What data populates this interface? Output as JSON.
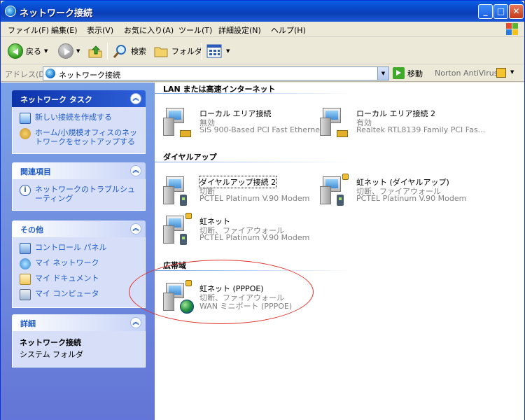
{
  "window": {
    "title": "ネットワーク接続",
    "min": "_",
    "max": "□",
    "close": "✕"
  },
  "menu": [
    "ファイル(F)",
    "編集(E)",
    "表示(V)",
    "お気に入り(A)",
    "ツール(T)",
    "詳細設定(N)",
    "ヘルプ(H)"
  ],
  "toolbar": {
    "back": "戻る",
    "search": "検索",
    "folders": "フォルダ"
  },
  "address": {
    "label": "アドレス(D)",
    "value": "ネットワーク接続",
    "go": "移動",
    "addon": "Norton AntiVirus"
  },
  "left": {
    "network_tasks": {
      "title": "ネットワーク タスク",
      "items": [
        "新しい接続を作成する",
        "ホーム/小規模オフィスのネットワークをセットアップする"
      ]
    },
    "related": {
      "title": "関連項目",
      "items": [
        "ネットワークのトラブルシューティング"
      ]
    },
    "other": {
      "title": "その他",
      "items": [
        "コントロール パネル",
        "マイ ネットワーク",
        "マイ ドキュメント",
        "マイ コンピュータ"
      ]
    },
    "details": {
      "title": "詳細",
      "name": "ネットワーク接続",
      "type": "システム フォルダ"
    }
  },
  "groups": {
    "lan": {
      "title": "LAN または高速インターネット",
      "items": [
        {
          "name": "ローカル エリア接続",
          "status": "無効",
          "device": "SiS 900-Based PCI Fast Etherne..."
        },
        {
          "name": "ローカル エリア接続 2",
          "status": "有効",
          "device": "Realtek RTL8139 Family PCI Fas..."
        }
      ]
    },
    "dialup": {
      "title": "ダイヤルアップ",
      "items": [
        {
          "name": "ダイヤルアップ接続 2",
          "status": "切断",
          "device": "PCTEL Platinum V.90 Modem"
        },
        {
          "name": "虹ネット (ダイヤルアップ)",
          "status": "切断、ファイアウォール",
          "device": "PCTEL Platinum V.90 Modem"
        },
        {
          "name": "虹ネット",
          "status": "切断、ファイアウォール",
          "device": "PCTEL Platinum V.90 Modem"
        }
      ]
    },
    "broadband": {
      "title": "広帯域",
      "items": [
        {
          "name": "虹ネット (PPPOE)",
          "status": "切断、ファイアウォール",
          "device": "WAN ミニポート (PPPOE)"
        }
      ]
    }
  },
  "colors": {
    "taskpane": "#6f8ee0",
    "link": "#215dc6",
    "annotation": "#e0302a"
  }
}
